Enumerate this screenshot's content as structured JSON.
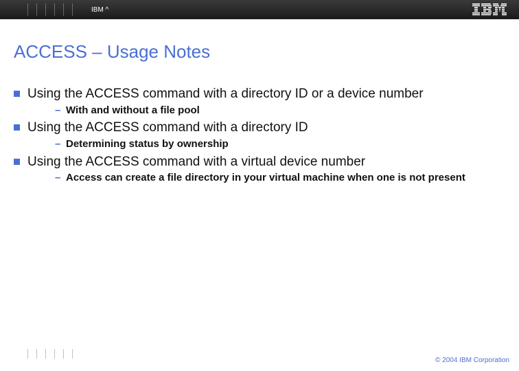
{
  "header": {
    "brand_text": "IBM ^"
  },
  "title": "ACCESS – Usage Notes",
  "bullets": [
    {
      "text": "Using the ACCESS command with a directory ID or a device number",
      "sub": [
        {
          "text": "With and without a file pool"
        }
      ]
    },
    {
      "text": "Using the ACCESS command with a directory ID",
      "sub": [
        {
          "text": "Determining status by ownership"
        }
      ]
    },
    {
      "text": "Using the ACCESS command with a virtual device number",
      "sub": [
        {
          "text": "Access can create a file directory in your virtual machine when one is not present"
        }
      ]
    }
  ],
  "footer": {
    "copyright": "© 2004 IBM Corporation"
  }
}
